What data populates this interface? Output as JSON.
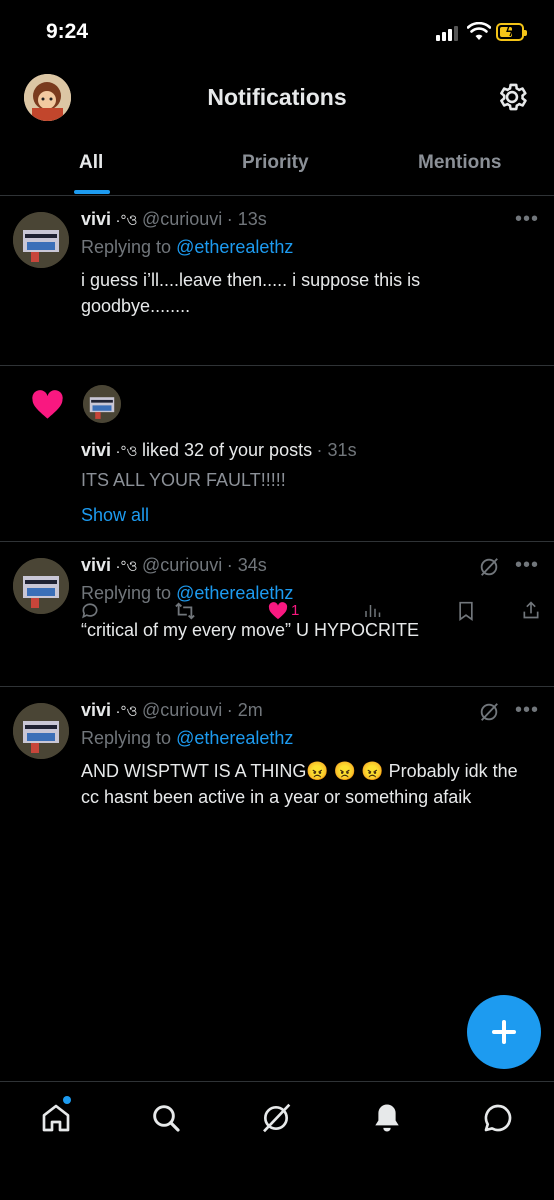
{
  "status_bar": {
    "time": "9:24"
  },
  "header": {
    "title": "Notifications"
  },
  "tabs": [
    {
      "label": "All",
      "active": true
    },
    {
      "label": "Priority",
      "active": false
    },
    {
      "label": "Mentions",
      "active": false
    }
  ],
  "notifications": [
    {
      "name": "vivi",
      "name_suffix": "·°ও",
      "handle": "@curiouvi",
      "time": "· 13s",
      "replying_prefix": "Replying to",
      "replying_handle": "@etherealethz",
      "text": "i guess i’ll....leave then..... i suppose this is goodbye........"
    },
    {
      "name": "vivi",
      "name_suffix": "·°ও",
      "action": "liked 32 of your posts",
      "time": "· 31s",
      "text": "ITS ALL YOUR FAULT!!!!!",
      "show_all": "Show all"
    },
    {
      "name": "vivi",
      "name_suffix": "·°ও",
      "handle": "@curiouvi",
      "time": "· 34s",
      "replying_prefix": "Replying to",
      "replying_handle": "@etherealethz",
      "text": "“critical of my every move” U HYPOCRITE",
      "like_count": "1"
    },
    {
      "name": "vivi",
      "name_suffix": "·°ও",
      "handle": "@curiouvi",
      "time": "· 2m",
      "replying_prefix": "Replying to",
      "replying_handle": "@etherealethz",
      "text": "AND WISPTWT IS A THING😠 😠 😠 Probably idk the cc hasnt been active in a year or something afaik"
    }
  ],
  "more_label": "•••",
  "colors": {
    "accent": "#1d9bf0",
    "like": "#f91880",
    "background": "#000000"
  }
}
